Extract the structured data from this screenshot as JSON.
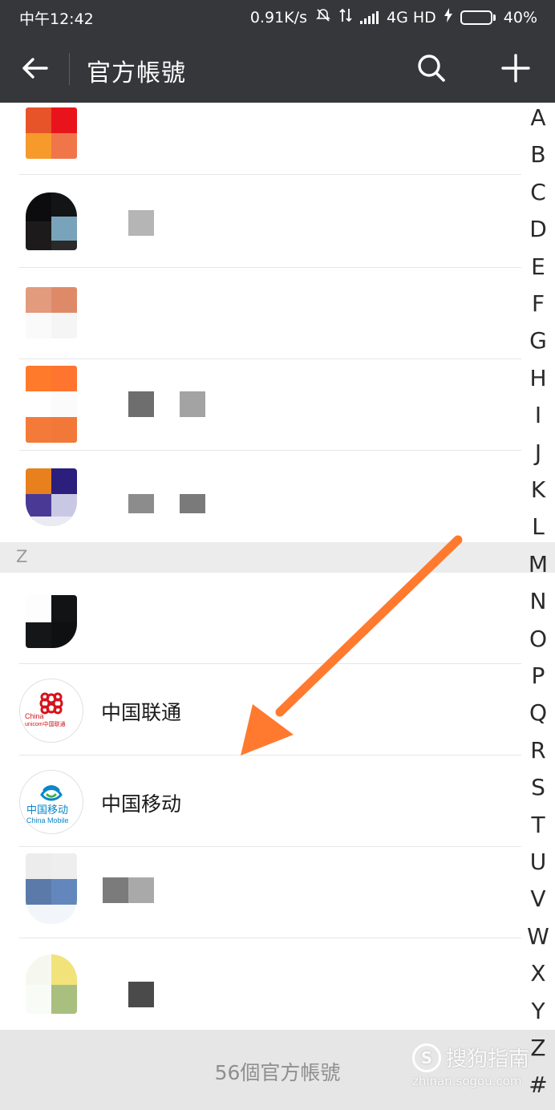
{
  "status_bar": {
    "time": "中午12:42",
    "network_speed": "0.91K/s",
    "network_type": "4G HD",
    "battery_percent": "40%",
    "battery_level": 0.4
  },
  "title_bar": {
    "back_icon": "arrow-left-icon",
    "title": "官方帳號",
    "search_icon": "search-icon",
    "add_icon": "plus-icon"
  },
  "section": {
    "letter": "Z"
  },
  "accounts": [
    {
      "name": "中国联通",
      "icon": "china-unicom-logo",
      "logo_line1": "China",
      "logo_line2": "unicom中国联通"
    },
    {
      "name": "中国移动",
      "icon": "china-mobile-logo",
      "logo_line1": "中国移动",
      "logo_line2": "China Mobile"
    }
  ],
  "index_letters": [
    "A",
    "B",
    "C",
    "D",
    "E",
    "F",
    "G",
    "H",
    "I",
    "J",
    "K",
    "L",
    "M",
    "N",
    "O",
    "P",
    "Q",
    "R",
    "S",
    "T",
    "U",
    "V",
    "W",
    "X",
    "Y",
    "Z",
    "#"
  ],
  "footer": {
    "count_text": "56個官方帳號"
  },
  "watermark": {
    "text": "搜狗指南",
    "url": "zhinan.sogou.com",
    "logo": "S"
  },
  "colors": {
    "header_bg": "#36373a",
    "section_bg": "#ececec",
    "footer_bg": "#e6e6e6",
    "arrow": "#ff7a2f",
    "battery": "#4cd964"
  }
}
